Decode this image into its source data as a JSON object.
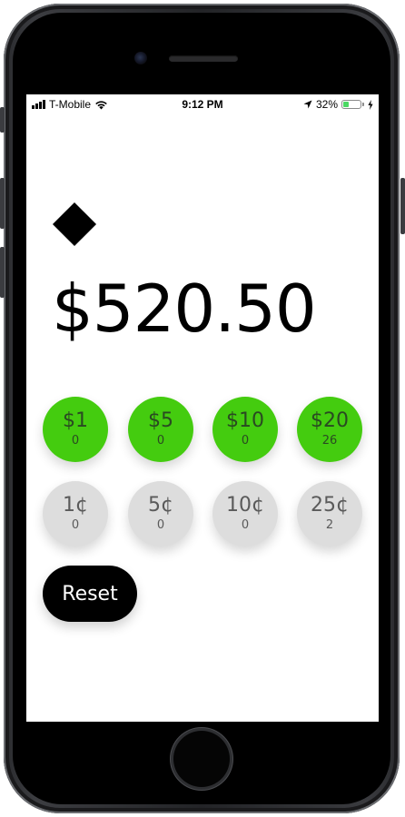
{
  "status_bar": {
    "carrier": "T-Mobile",
    "time": "9:12 PM",
    "battery_percent": "32%",
    "battery_level": 0.32,
    "battery_color": "#4cd964",
    "icons": [
      "signal-bars-icon",
      "wifi-icon",
      "location-arrow-icon",
      "battery-icon",
      "charging-bolt-icon"
    ]
  },
  "app": {
    "logo_icon": "diamond-icon",
    "total": "$520.50"
  },
  "bills": [
    {
      "label": "$1",
      "count": "0"
    },
    {
      "label": "$5",
      "count": "0"
    },
    {
      "label": "$10",
      "count": "0"
    },
    {
      "label": "$20",
      "count": "26"
    }
  ],
  "coins": [
    {
      "label": "1¢",
      "count": "0"
    },
    {
      "label": "5¢",
      "count": "0"
    },
    {
      "label": "10¢",
      "count": "0"
    },
    {
      "label": "25¢",
      "count": "2"
    }
  ],
  "reset_label": "Reset",
  "colors": {
    "bill_green": "#44cc0f",
    "coin_gray": "#dddddd",
    "reset_black": "#000000"
  }
}
